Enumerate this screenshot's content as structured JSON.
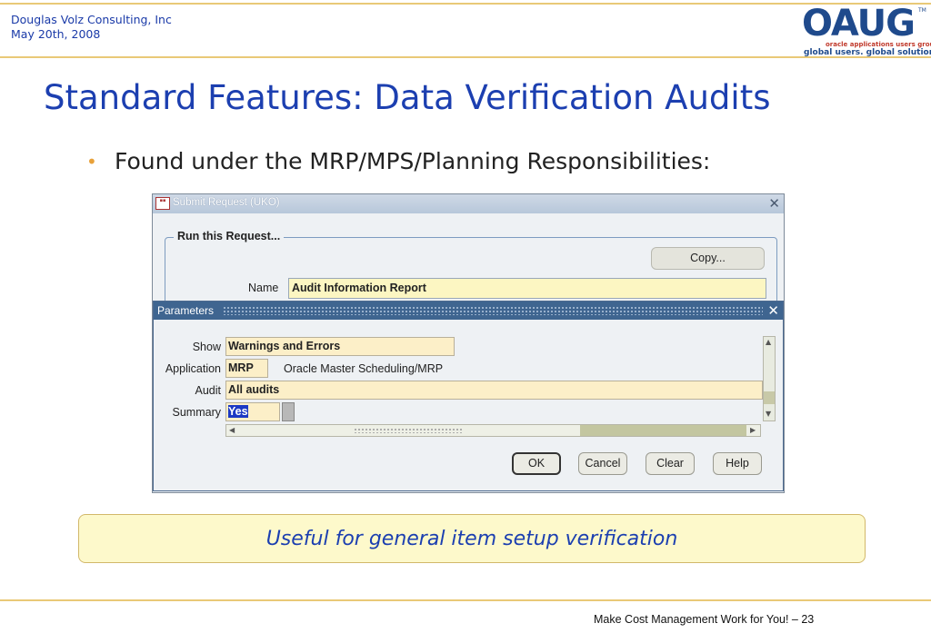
{
  "header": {
    "company": "Douglas Volz Consulting, Inc",
    "date": "May 20th, 2008",
    "logo": {
      "text": "OAUG",
      "subtitle": "oracle applications users group",
      "tagline": "global users. global solutions.",
      "tm": "TM"
    }
  },
  "slide": {
    "title": "Standard Features:  Data Verification Audits",
    "bullet": "Found under the MRP/MPS/Planning Responsibilities:"
  },
  "submit_window": {
    "title": "Submit Request (UKO)",
    "group_label": "Run this Request...",
    "copy_button": "Copy...",
    "name_label": "Name",
    "name_value": "Audit Information Report"
  },
  "params_window": {
    "title": "Parameters",
    "fields": {
      "show_label": "Show",
      "show_value": "Warnings and Errors",
      "application_label": "Application",
      "application_value": "MRP",
      "application_desc": "Oracle Master Scheduling/MRP",
      "audit_label": "Audit",
      "audit_value": "All audits",
      "summary_label": "Summary",
      "summary_value": "Yes"
    },
    "buttons": {
      "ok": "OK",
      "cancel": "Cancel",
      "clear": "Clear",
      "help": "Help"
    }
  },
  "callout": "Useful for general item setup verification",
  "footer": "Make Cost Management Work for You! – 23",
  "colors": {
    "title_blue": "#1c3fb0",
    "accent_gold": "#e9c977",
    "callout_bg": "#fdf9cb",
    "param_titlebar": "#3f6590"
  }
}
